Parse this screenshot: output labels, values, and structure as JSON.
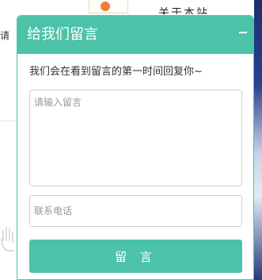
{
  "background": {
    "left_text": "请",
    "top_text": "关于本站"
  },
  "widget": {
    "title": "给我们留言",
    "intro": "我们会在看到留言的第一时间回复你~",
    "message_placeholder": "请输入留言",
    "phone_placeholder": "联系电话",
    "submit_label": "留 言",
    "accent_color": "#4cc3a8"
  }
}
